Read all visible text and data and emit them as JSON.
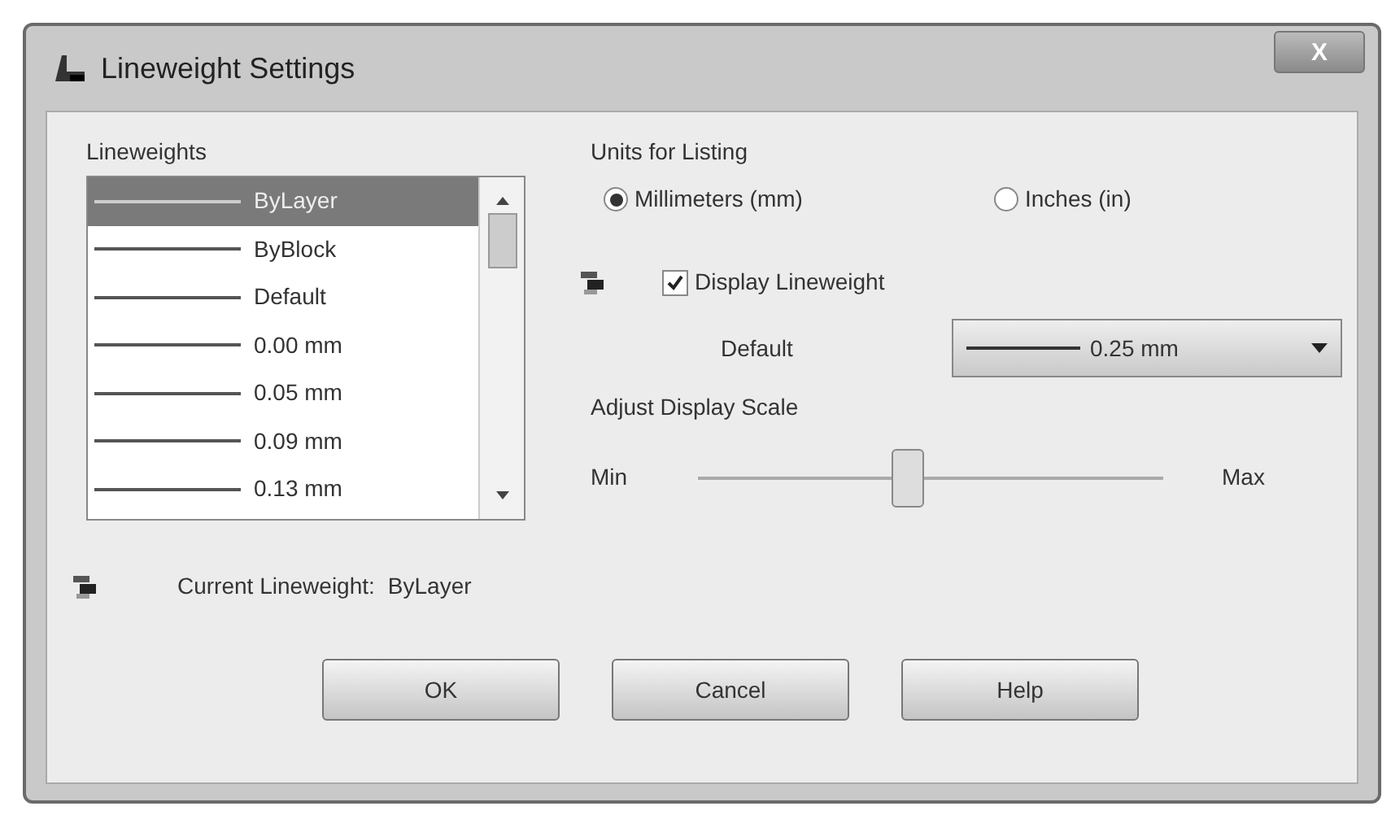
{
  "window": {
    "title": "Lineweight Settings",
    "close": "X"
  },
  "lineweights": {
    "label": "Lineweights",
    "items": [
      {
        "text": "ByLayer",
        "selected": true
      },
      {
        "text": "ByBlock",
        "selected": false
      },
      {
        "text": "Default",
        "selected": false
      },
      {
        "text": "0.00 mm",
        "selected": false
      },
      {
        "text": "0.05 mm",
        "selected": false
      },
      {
        "text": "0.09 mm",
        "selected": false
      },
      {
        "text": "0.13 mm",
        "selected": false
      }
    ]
  },
  "units": {
    "label": "Units for Listing",
    "options": [
      {
        "text": "Millimeters (mm)",
        "selected": true
      },
      {
        "text": "Inches (in)",
        "selected": false
      }
    ]
  },
  "display_lineweight": {
    "text": "Display Lineweight",
    "checked": true
  },
  "default": {
    "label": "Default",
    "value": "0.25 mm"
  },
  "scale": {
    "label": "Adjust Display Scale",
    "min": "Min",
    "max": "Max",
    "level": 0.45
  },
  "current": {
    "label": "Current Lineweight:",
    "value": "ByLayer"
  },
  "buttons": [
    "OK",
    "Cancel",
    "Help"
  ]
}
